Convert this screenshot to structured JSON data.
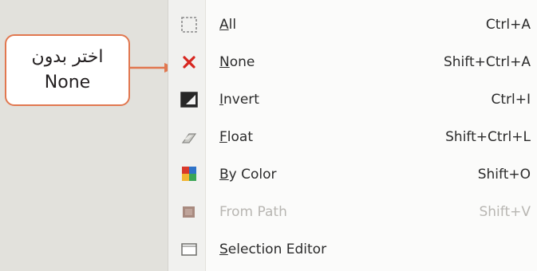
{
  "callout": {
    "line1": "اختر بدون",
    "line2": "None"
  },
  "menu": {
    "items": [
      {
        "mn": "A",
        "rest": "ll",
        "shortcut": "Ctrl+A",
        "icon": "select-all-icon"
      },
      {
        "mn": "N",
        "rest": "one",
        "shortcut": "Shift+Ctrl+A",
        "icon": "red-x-icon"
      },
      {
        "mn": "I",
        "rest": "nvert",
        "shortcut": "Ctrl+I",
        "icon": "invert-icon"
      },
      {
        "mn": "F",
        "rest": "loat",
        "shortcut": "Shift+Ctrl+L",
        "icon": "float-icon"
      },
      {
        "mn": "B",
        "rest": "y Color",
        "shortcut": "Shift+O",
        "icon": "color-select-icon"
      },
      {
        "mn": "",
        "rest": "From Path",
        "shortcut": "Shift+V",
        "icon": "path-icon",
        "disabled": true
      },
      {
        "mn": "S",
        "rest": "election Editor",
        "shortcut": "",
        "icon": "selection-editor-icon"
      }
    ]
  },
  "colors": {
    "callout_border": "#e1774f",
    "arrow": "#e1774f",
    "x_icon": "#d7261f"
  }
}
